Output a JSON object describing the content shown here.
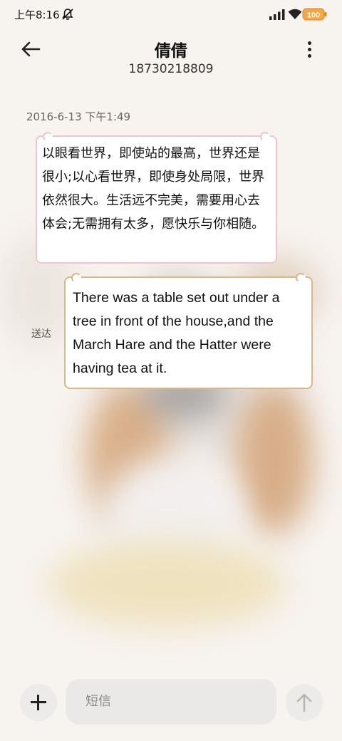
{
  "status_bar": {
    "time": "上午8:16",
    "battery": "100"
  },
  "header": {
    "contact_name": "倩倩",
    "phone_number": "18730218809"
  },
  "conversation": {
    "timestamp": "2016-6-13 下午1:49",
    "messages": [
      {
        "direction": "incoming",
        "text": "以眼看世界，即使站的最高，世界还是很小;以心看世界，即使身处局限，世界依然很大。生活远不完美，需要用心去体会;无需拥有太多，愿快乐与你相随。"
      },
      {
        "direction": "outgoing",
        "text": "There was a table set out under a tree in front of the house,and the March Hare and the Hatter were having tea at it.",
        "status": "送达"
      }
    ]
  },
  "composer": {
    "placeholder": "短信"
  },
  "colors": {
    "incoming_border": "#f3c4cf",
    "outgoing_border": "#d8b887",
    "battery_fill": "#f5a742"
  }
}
